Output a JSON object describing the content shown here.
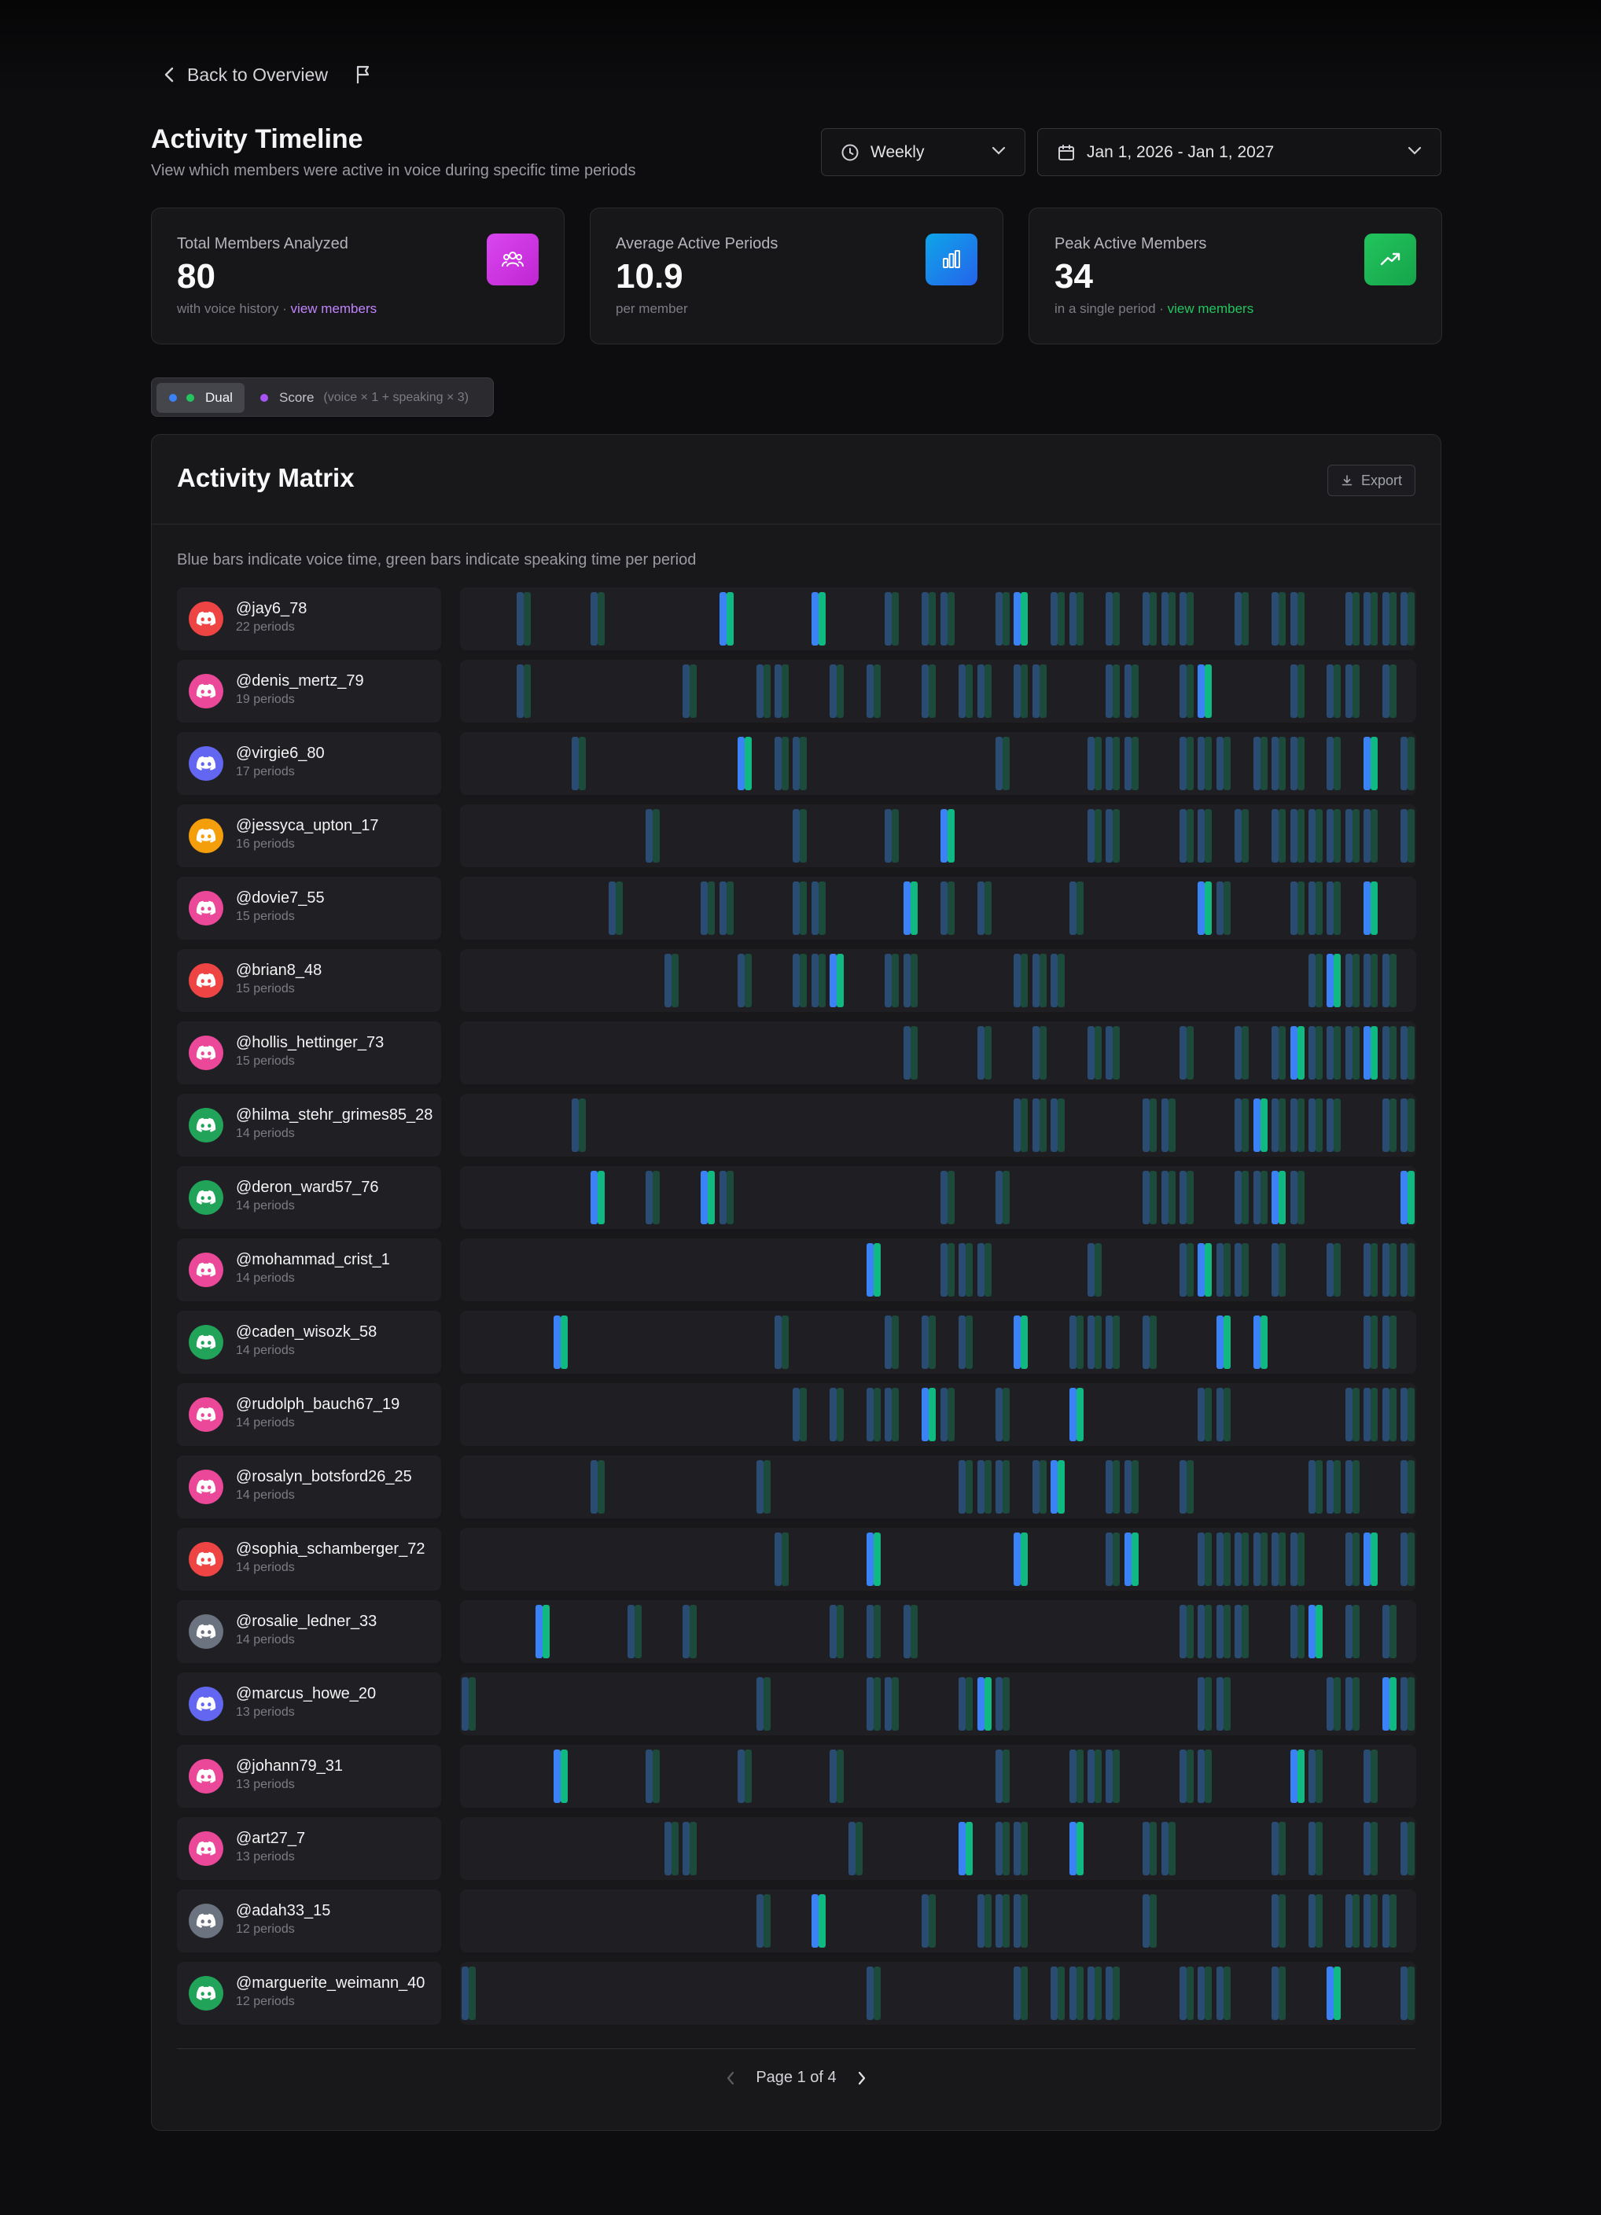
{
  "nav": {
    "back_label": "Back to Overview"
  },
  "header": {
    "title": "Activity Timeline",
    "subtitle": "View which members were active in voice during specific time periods",
    "period_select": "Weekly",
    "date_range": "Jan 1, 2026 - Jan 1, 2027"
  },
  "stats": [
    {
      "label": "Total Members Analyzed",
      "value": "80",
      "sub": "with voice history · ",
      "link": "view members",
      "color": "#d946ef",
      "icon": "users-icon"
    },
    {
      "label": "Average Active Periods",
      "value": "10.9",
      "sub": "per member",
      "link": "",
      "color": "#0ea5e9",
      "icon": "bar-chart-icon"
    },
    {
      "label": "Peak Active Members",
      "value": "34",
      "sub": "in a single period · ",
      "link": "view members",
      "color": "#16a34a",
      "icon": "trending-up-icon"
    }
  ],
  "mode_toggle": {
    "dual_label": "Dual",
    "score_label": "Score",
    "score_formula": "(voice × 1 + speaking × 3)"
  },
  "matrix": {
    "title": "Activity Matrix",
    "export_label": "Export",
    "hint": "Blue bars indicate voice time, green bars indicate speaking time per period",
    "period_count": 52,
    "members": [
      {
        "name": "@jay6_78",
        "periods": "22 periods",
        "avatar_color": "#ef4444",
        "active": [
          3,
          7,
          14,
          19,
          23,
          25,
          26,
          29,
          30,
          32,
          33,
          35,
          37,
          38,
          39,
          42,
          44,
          45,
          48,
          49,
          50,
          51
        ],
        "highlight": [
          14,
          19,
          30
        ]
      },
      {
        "name": "@denis_mertz_79",
        "periods": "19 periods",
        "avatar_color": "#ec4899",
        "active": [
          3,
          12,
          16,
          17,
          20,
          22,
          25,
          27,
          28,
          30,
          31,
          35,
          36,
          39,
          40,
          45,
          47,
          48,
          50
        ],
        "highlight": [
          40
        ]
      },
      {
        "name": "@virgie6_80",
        "periods": "17 periods",
        "avatar_color": "#6366f1",
        "active": [
          6,
          15,
          17,
          18,
          29,
          34,
          35,
          36,
          39,
          40,
          41,
          43,
          44,
          45,
          47,
          49,
          51
        ],
        "highlight": [
          15,
          49
        ]
      },
      {
        "name": "@jessyca_upton_17",
        "periods": "16 periods",
        "avatar_color": "#f59e0b",
        "active": [
          10,
          18,
          23,
          26,
          34,
          35,
          39,
          40,
          42,
          44,
          45,
          46,
          47,
          48,
          49,
          51
        ],
        "highlight": [
          26
        ]
      },
      {
        "name": "@dovie7_55",
        "periods": "15 periods",
        "avatar_color": "#ec4899",
        "active": [
          8,
          13,
          14,
          18,
          19,
          24,
          26,
          28,
          33,
          40,
          41,
          45,
          46,
          47,
          49
        ],
        "highlight": [
          24,
          40,
          49
        ]
      },
      {
        "name": "@brian8_48",
        "periods": "15 periods",
        "avatar_color": "#ef4444",
        "active": [
          11,
          15,
          18,
          19,
          20,
          23,
          24,
          30,
          31,
          32,
          46,
          47,
          48,
          49,
          50
        ],
        "highlight": [
          20,
          47
        ]
      },
      {
        "name": "@hollis_hettinger_73",
        "periods": "15 periods",
        "avatar_color": "#ec4899",
        "active": [
          24,
          28,
          31,
          34,
          35,
          39,
          42,
          44,
          45,
          46,
          47,
          48,
          49,
          50,
          51
        ],
        "highlight": [
          45,
          49
        ]
      },
      {
        "name": "@hilma_stehr_grimes85_28",
        "periods": "14 periods",
        "avatar_color": "#22a35a",
        "active": [
          6,
          30,
          31,
          32,
          37,
          38,
          42,
          43,
          44,
          45,
          46,
          47,
          50,
          51
        ],
        "highlight": [
          43
        ]
      },
      {
        "name": "@deron_ward57_76",
        "periods": "14 periods",
        "avatar_color": "#22a35a",
        "active": [
          7,
          10,
          13,
          14,
          26,
          29,
          37,
          38,
          39,
          42,
          43,
          44,
          45,
          51
        ],
        "highlight": [
          7,
          13,
          44,
          51
        ]
      },
      {
        "name": "@mohammad_crist_1",
        "periods": "14 periods",
        "avatar_color": "#ec4899",
        "active": [
          22,
          26,
          27,
          28,
          34,
          39,
          40,
          41,
          42,
          44,
          47,
          49,
          50,
          51
        ],
        "highlight": [
          22,
          40
        ]
      },
      {
        "name": "@caden_wisozk_58",
        "periods": "14 periods",
        "avatar_color": "#22a35a",
        "active": [
          5,
          17,
          23,
          25,
          27,
          30,
          33,
          34,
          35,
          37,
          41,
          43,
          49,
          50
        ],
        "highlight": [
          5,
          30,
          41,
          43
        ]
      },
      {
        "name": "@rudolph_bauch67_19",
        "periods": "14 periods",
        "avatar_color": "#ec4899",
        "active": [
          18,
          20,
          22,
          23,
          25,
          26,
          29,
          33,
          40,
          41,
          48,
          49,
          50,
          51
        ],
        "highlight": [
          25,
          33
        ]
      },
      {
        "name": "@rosalyn_botsford26_25",
        "periods": "14 periods",
        "avatar_color": "#ec4899",
        "active": [
          7,
          16,
          27,
          28,
          29,
          31,
          32,
          35,
          36,
          39,
          46,
          47,
          48,
          51
        ],
        "highlight": [
          32
        ]
      },
      {
        "name": "@sophia_schamberger_72",
        "periods": "14 periods",
        "avatar_color": "#ef4444",
        "active": [
          17,
          22,
          30,
          35,
          36,
          40,
          41,
          42,
          43,
          44,
          45,
          48,
          49,
          51
        ],
        "highlight": [
          22,
          30,
          36,
          49
        ]
      },
      {
        "name": "@rosalie_ledner_33",
        "periods": "14 periods",
        "avatar_color": "#6b7280",
        "active": [
          4,
          9,
          12,
          20,
          22,
          24,
          39,
          40,
          41,
          42,
          45,
          46,
          48,
          50
        ],
        "highlight": [
          4,
          46
        ]
      },
      {
        "name": "@marcus_howe_20",
        "periods": "13 periods",
        "avatar_color": "#6366f1",
        "active": [
          0,
          16,
          22,
          23,
          27,
          28,
          29,
          40,
          41,
          47,
          48,
          50,
          51
        ],
        "highlight": [
          28,
          50
        ]
      },
      {
        "name": "@johann79_31",
        "periods": "13 periods",
        "avatar_color": "#ec4899",
        "active": [
          5,
          10,
          15,
          20,
          29,
          33,
          34,
          35,
          39,
          40,
          45,
          46,
          49
        ],
        "highlight": [
          5,
          45
        ]
      },
      {
        "name": "@art27_7",
        "periods": "13 periods",
        "avatar_color": "#ec4899",
        "active": [
          11,
          12,
          21,
          27,
          29,
          30,
          33,
          37,
          38,
          44,
          46,
          49,
          51
        ],
        "highlight": [
          27,
          33
        ]
      },
      {
        "name": "@adah33_15",
        "periods": "12 periods",
        "avatar_color": "#6b7280",
        "active": [
          16,
          19,
          25,
          28,
          29,
          30,
          37,
          44,
          46,
          48,
          49,
          50
        ],
        "highlight": [
          19
        ]
      },
      {
        "name": "@marguerite_weimann_40",
        "periods": "12 periods",
        "avatar_color": "#22a35a",
        "active": [
          0,
          22,
          30,
          32,
          33,
          34,
          35,
          39,
          40,
          41,
          44,
          47,
          51
        ],
        "highlight": [
          47
        ]
      }
    ]
  },
  "pagination": {
    "label": "Page 1 of 4"
  }
}
